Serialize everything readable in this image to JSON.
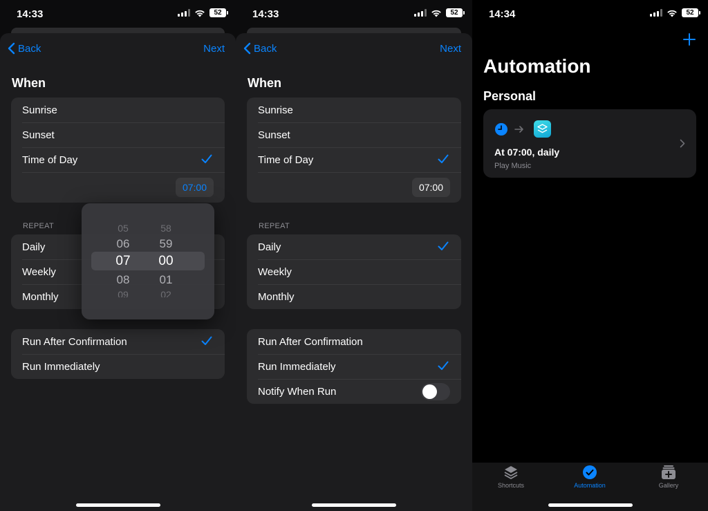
{
  "status_bars": [
    {
      "time": "14:33",
      "battery": "52"
    },
    {
      "time": "14:33",
      "battery": "52"
    },
    {
      "time": "14:34",
      "battery": "52"
    }
  ],
  "panel1": {
    "back_label": "Back",
    "next_label": "Next",
    "heading": "When",
    "when_options": [
      "Sunrise",
      "Sunset",
      "Time of Day"
    ],
    "time_value": "07:00",
    "repeat_label": "REPEAT",
    "repeat_options": [
      "Daily",
      "Weekly",
      "Monthly"
    ],
    "run_options": [
      "Run After Confirmation",
      "Run Immediately"
    ],
    "picker": {
      "hours": [
        "05",
        "06",
        "07",
        "08",
        "09"
      ],
      "minutes": [
        "58",
        "59",
        "00",
        "01",
        "02"
      ]
    }
  },
  "panel2": {
    "back_label": "Back",
    "next_label": "Next",
    "heading": "When",
    "when_options": [
      "Sunrise",
      "Sunset",
      "Time of Day"
    ],
    "time_value": "07:00",
    "repeat_label": "REPEAT",
    "repeat_options": [
      "Daily",
      "Weekly",
      "Monthly"
    ],
    "run_options": [
      "Run After Confirmation",
      "Run Immediately",
      "Notify When Run"
    ]
  },
  "panel3": {
    "title": "Automation",
    "section": "Personal",
    "card": {
      "title": "At 07:00, daily",
      "subtitle": "Play Music"
    },
    "tabs": [
      "Shortcuts",
      "Automation",
      "Gallery"
    ]
  },
  "colors": {
    "accent": "#0a84ff",
    "background": "#000000",
    "group": "#2c2c2e"
  }
}
